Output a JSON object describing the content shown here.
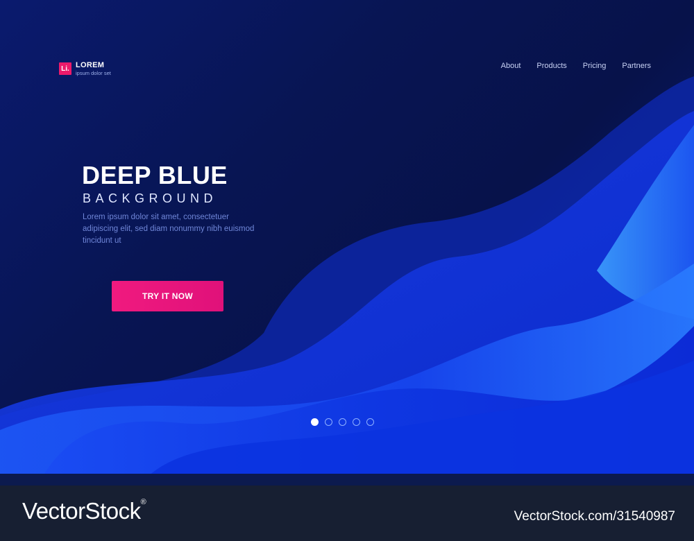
{
  "brand": {
    "mark": "Li.",
    "name": "LOREM",
    "tagline": "ipsum dolor set"
  },
  "nav": {
    "items": [
      "About",
      "Products",
      "Pricing",
      "Partners"
    ]
  },
  "hero": {
    "title": "DEEP BLUE",
    "subtitle": "BACKGROUND",
    "description": "Lorem ipsum dolor sit amet, consectetuer adipiscing elit, sed diam nonummy nibh euismod tincidunt ut",
    "cta_label": "TRY IT NOW"
  },
  "carousel": {
    "count": 5,
    "active_index": 0
  },
  "watermark": {
    "left": "VectorStock",
    "registered": "®",
    "right": "VectorStock.com/31540987"
  },
  "colors": {
    "accent": "#ec1a6b",
    "background": "#081553",
    "wave": "#1244f0",
    "footer": "#171f32"
  }
}
